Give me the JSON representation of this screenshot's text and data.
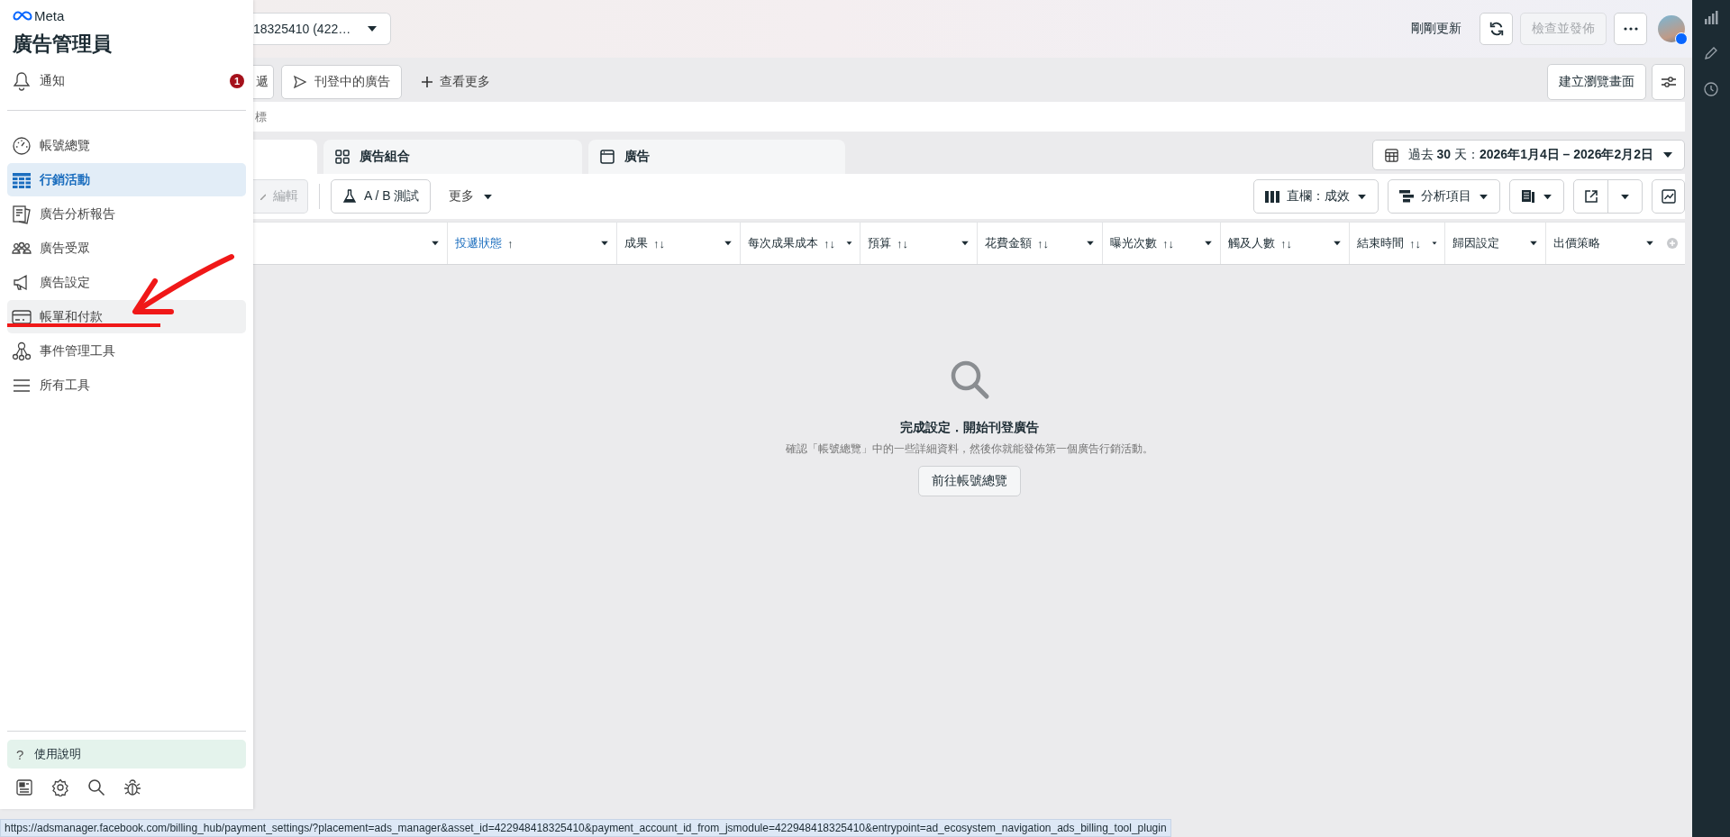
{
  "sidebar": {
    "brand": "Meta",
    "title": "廣告管理員",
    "notification": {
      "label": "通知",
      "count": "1"
    },
    "items": [
      {
        "label": "帳號總覽",
        "selected": false,
        "hovered": false
      },
      {
        "label": "行銷活動",
        "selected": true,
        "hovered": false
      },
      {
        "label": "廣告分析報告",
        "selected": false,
        "hovered": false
      },
      {
        "label": "廣告受眾",
        "selected": false,
        "hovered": false
      },
      {
        "label": "廣告設定",
        "selected": false,
        "hovered": false
      },
      {
        "label": "帳單和付款",
        "selected": false,
        "hovered": true
      },
      {
        "label": "事件管理工具",
        "selected": false,
        "hovered": false
      },
      {
        "label": "所有工具",
        "selected": false,
        "hovered": false
      }
    ],
    "help": {
      "icon": "?",
      "label": "使用說明"
    }
  },
  "top_bar": {
    "account": "18325410 (422…",
    "status_text": "剛剛更新",
    "publish_button": {
      "label": "檢查並發佈",
      "disabled": true
    }
  },
  "filters": [
    {
      "label": "遞"
    },
    {
      "label": "刊登中的廣告"
    }
  ],
  "see_more": "查看更多",
  "create_view": "建立瀏覽畫面",
  "search": {
    "placeholder": "標"
  },
  "tabs": [
    {
      "selected": true
    },
    {
      "label": "廣告組合",
      "selected": false
    },
    {
      "label": "廣告",
      "selected": false
    }
  ],
  "date_range": "過去 **30** 天：**2026年1月4日 – 2026年2月2日**",
  "toolbar": {
    "edit": {
      "label": "編輯",
      "disabled": true
    },
    "ab_test": "A / B 測試",
    "more": "更多",
    "columns": "直欄：成效",
    "breakdown": "分析項目"
  },
  "table": {
    "columns": [
      {},
      {
        "label": "投遞狀態",
        "sort_mark": "↑",
        "sorted": true
      },
      {
        "label": "成果",
        "sort_mark": "↑↓",
        "sorted": false
      },
      {
        "label": "每次成果成本",
        "sort_mark": "↑↓",
        "sorted": false
      },
      {
        "label": "預算",
        "sort_mark": "↑↓",
        "sorted": false
      },
      {
        "label": "花費金額",
        "sort_mark": "↑↓",
        "sorted": false
      },
      {
        "label": "曝光次數",
        "sort_mark": "↑↓",
        "sorted": false
      },
      {
        "label": "觸及人數",
        "sort_mark": "↑↓",
        "sorted": false
      },
      {
        "label": "結束時間",
        "sort_mark": "↑↓",
        "sorted": false
      },
      {
        "label": "歸因設定",
        "sorted": false
      },
      {
        "label": "出價策略",
        "sorted": false
      }
    ]
  },
  "empty_state": {
    "title": "完成設定．開始刊登廣告",
    "description": "確認「帳號總覽」中的一些詳細資料，然後你就能發佈第一個廣告行銷活動。",
    "button": "前往帳號總覽"
  },
  "status_bar": {
    "url": "https://adsmanager.facebook.com/billing_hub/payment_settings/?placement=ads_manager&asset_id=422948418325410&payment_account_id_from_jsmodule=422948418325410&entrypoint=ad_ecosystem_navigation_ads_billing_tool_plugin"
  }
}
